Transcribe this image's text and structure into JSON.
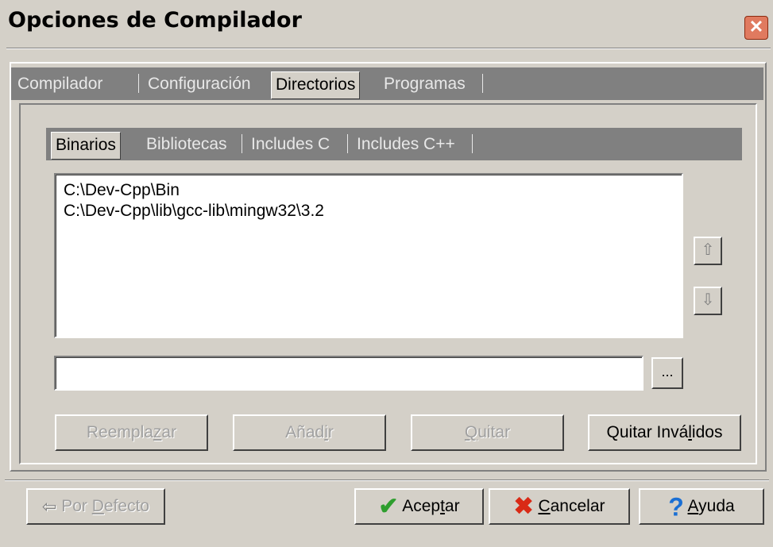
{
  "window": {
    "title": "Opciones de Compilador",
    "close_glyph": "✕"
  },
  "outer_tabs": [
    {
      "label": "Compilador",
      "active": false
    },
    {
      "label": "Configuración",
      "active": false
    },
    {
      "label": "Directorios",
      "active": true
    },
    {
      "label": "Programas",
      "active": false
    }
  ],
  "inner_tabs": [
    {
      "label": "Binarios",
      "active": true
    },
    {
      "label": "Bibliotecas",
      "active": false
    },
    {
      "label": "Includes C",
      "active": false
    },
    {
      "label": "Includes C++",
      "active": false
    }
  ],
  "directory_list": [
    "C:\\Dev-Cpp\\Bin",
    "C:\\Dev-Cpp\\lib\\gcc-lib\\mingw32\\3.2"
  ],
  "path_input": {
    "value": ""
  },
  "browse_button": {
    "label": "..."
  },
  "move_up_icon": "chevron-up-arrow-icon",
  "move_down_icon": "chevron-down-arrow-icon",
  "action_buttons": {
    "replace": {
      "pre": "Reempla",
      "ul": "z",
      "post": "ar",
      "enabled": false
    },
    "add": {
      "pre": "Añad",
      "ul": "i",
      "post": "r",
      "enabled": false
    },
    "remove": {
      "pre": "",
      "ul": "Q",
      "post": "uitar",
      "enabled": false
    },
    "remove_invalid": {
      "pre": "Quitar Invá",
      "ul": "l",
      "post": "idos",
      "enabled": true
    }
  },
  "footer_buttons": {
    "defaults": {
      "pre": "Por ",
      "ul": "D",
      "post": "efecto",
      "enabled": false
    },
    "accept": {
      "pre": "Acep",
      "ul": "t",
      "post": "ar"
    },
    "cancel": {
      "pre": "",
      "ul": "C",
      "post": "ancelar"
    },
    "help": {
      "pre": "",
      "ul": "A",
      "post": "yuda"
    }
  },
  "colors": {
    "face": "#d4d0c8",
    "tabbar": "#808080",
    "accept_icon": "#2e9e2e",
    "cancel_icon": "#d92a16",
    "help_icon": "#1a6fd4"
  }
}
